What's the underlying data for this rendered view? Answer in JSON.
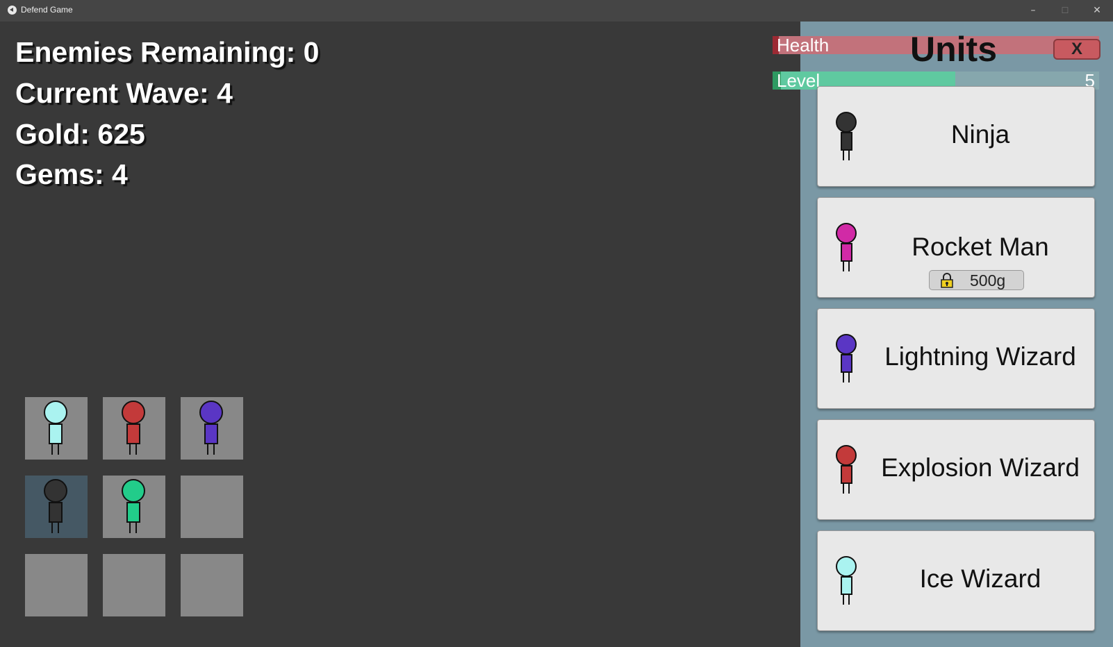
{
  "window": {
    "title": "Defend Game",
    "minimize": "–",
    "maximize": "☐",
    "close": "✕"
  },
  "stats": {
    "enemies": "Enemies Remaining: 0",
    "wave": "Current Wave: 4",
    "gold": "Gold: 625",
    "gems": "Gems: 4"
  },
  "grid": {
    "slots": [
      {
        "unit": "ice-wizard",
        "color": "#aaf3f0"
      },
      {
        "unit": "explosion-wizard",
        "color": "#c33a3a"
      },
      {
        "unit": "lightning-wizard",
        "color": "#5a36c4"
      },
      {
        "unit": "ninja",
        "color": "#333333",
        "selected": true
      },
      {
        "unit": "green-unit",
        "color": "#22cc8a"
      },
      {
        "unit": null
      },
      {
        "unit": null
      },
      {
        "unit": null
      },
      {
        "unit": null
      }
    ]
  },
  "panel": {
    "title": "Units",
    "close_label": "X",
    "health_label": "Health",
    "health_fraction": 0.02,
    "level_label": "Level",
    "level_value": "5",
    "level_fraction": 0.56,
    "colors": {
      "health": "#9c2a33",
      "level": "#5fc9a0",
      "panel_bg": "#7a98a5"
    },
    "units": [
      {
        "name": "Ninja",
        "color": "#333333",
        "locked": false
      },
      {
        "name": "Rocket Man",
        "color": "#d12aa6",
        "locked": true,
        "price": "500g",
        "icon": "lock-icon"
      },
      {
        "name": "Lightning Wizard",
        "color": "#5a36c4",
        "locked": false
      },
      {
        "name": "Explosion Wizard",
        "color": "#c33a3a",
        "locked": false
      },
      {
        "name": "Ice Wizard",
        "color": "#aaf3f0",
        "locked": false
      }
    ]
  }
}
